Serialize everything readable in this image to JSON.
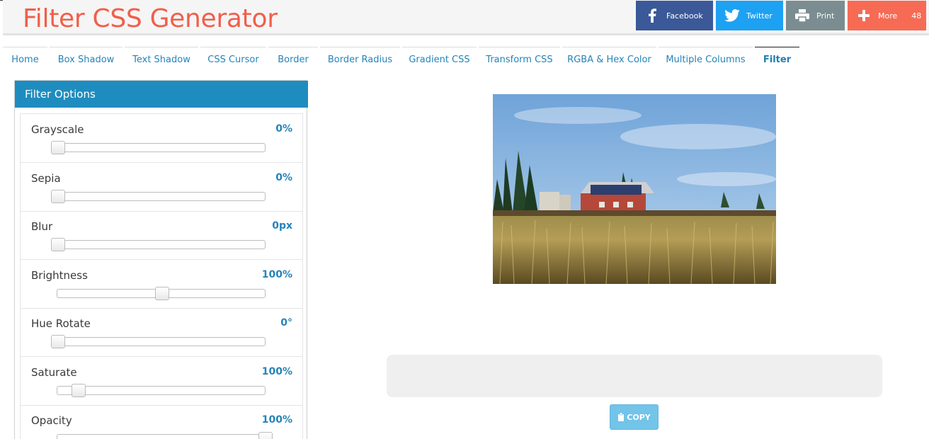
{
  "header": {
    "title": "Filter CSS Generator",
    "share": {
      "facebook": "Facebook",
      "twitter": "Twitter",
      "print": "Print",
      "more": "More",
      "more_count": "48"
    },
    "colors": {
      "title": "#f05f4a",
      "facebook": "#3b5998",
      "twitter": "#1da1f2",
      "print": "#7b8d90",
      "more": "#f76b55"
    }
  },
  "nav": {
    "items": [
      {
        "label": "Home"
      },
      {
        "label": "Box Shadow"
      },
      {
        "label": "Text Shadow"
      },
      {
        "label": "CSS Cursor"
      },
      {
        "label": "Border"
      },
      {
        "label": "Border Radius"
      },
      {
        "label": "Gradient CSS"
      },
      {
        "label": "Transform CSS"
      },
      {
        "label": "RGBA & Hex Color"
      },
      {
        "label": "Multiple Columns"
      },
      {
        "label": "Filter"
      }
    ],
    "active": "Filter"
  },
  "panel": {
    "title": "Filter Options",
    "options": [
      {
        "label": "Grayscale",
        "value": "0%",
        "slider_fraction": 0.0
      },
      {
        "label": "Sepia",
        "value": "0%",
        "slider_fraction": 0.0
      },
      {
        "label": "Blur",
        "value": "0px",
        "slider_fraction": 0.0
      },
      {
        "label": "Brightness",
        "value": "100%",
        "slider_fraction": 0.5
      },
      {
        "label": "Hue Rotate",
        "value": "0°",
        "slider_fraction": 0.0
      },
      {
        "label": "Saturate",
        "value": "100%",
        "slider_fraction": 0.1
      },
      {
        "label": "Opacity",
        "value": "100%",
        "slider_fraction": 1.0
      }
    ]
  },
  "preview": {
    "image": "farmhouse-field-photo"
  },
  "copy_button": {
    "label": "COPY",
    "icon": "clipboard-icon"
  }
}
